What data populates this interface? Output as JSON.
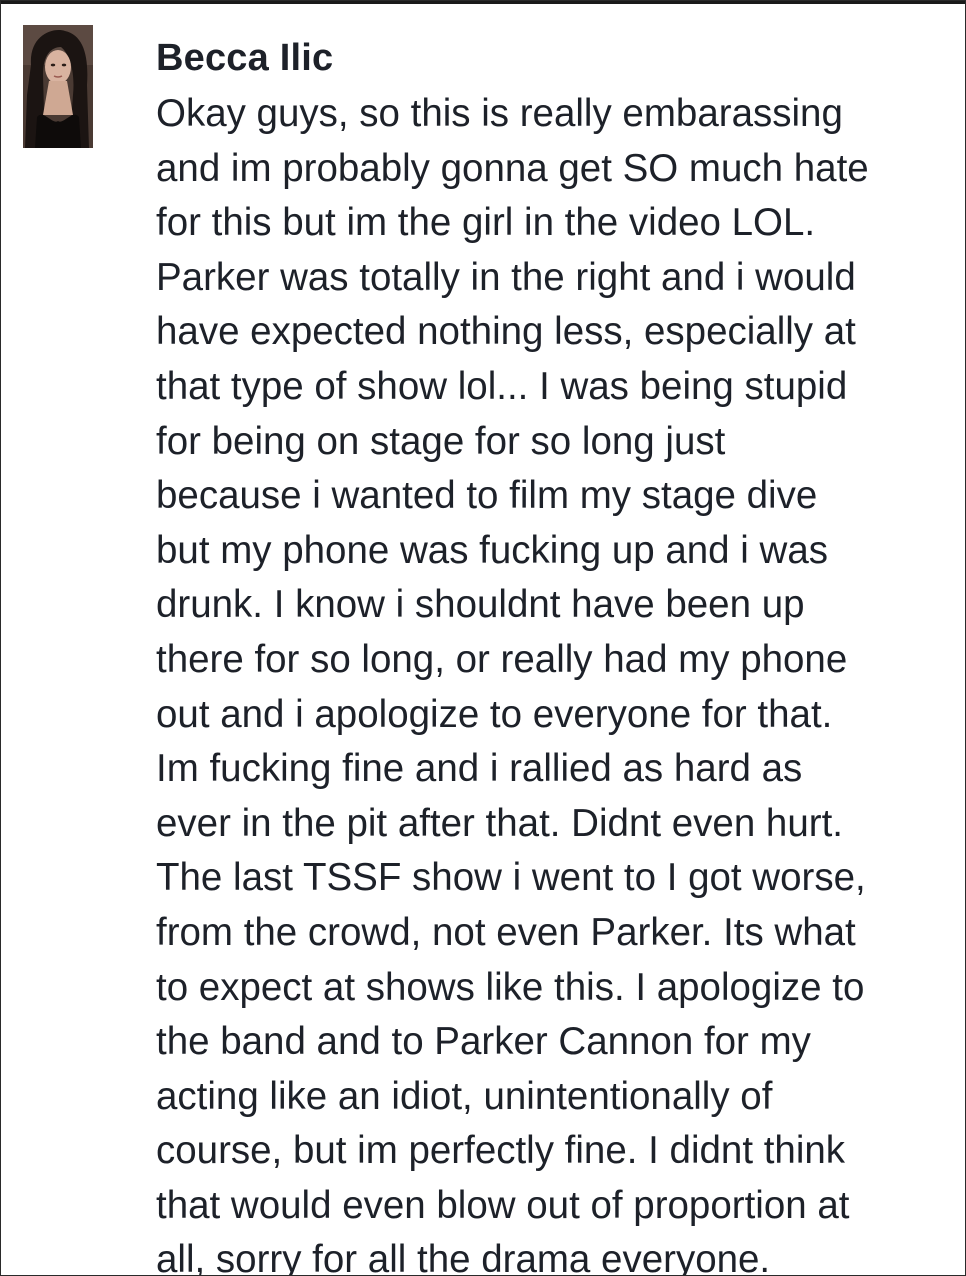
{
  "post": {
    "author": "Becca Ilic",
    "avatar_icon": "profile-photo",
    "lines": [
      "Okay guys, so this is really embarassing",
      "and im probably gonna get SO much hate",
      "for this but im the girl in the video LOL.",
      "Parker was totally in the right and i would",
      "have expected nothing less, especially at",
      "that type of show lol... I was being stupid",
      "for being on stage for so long just",
      "because i wanted to film my stage dive",
      "but my phone was fucking up and i was",
      "drunk. I know i shouldnt have been up",
      "there for so long, or really had my phone",
      "out and i apologize to everyone for that.",
      "Im fucking fine and i rallied as hard as",
      "ever in the pit after that. Didnt even hurt.",
      "The last TSSF show i went to I got worse,",
      "from the crowd, not even Parker. Its what",
      "to expect at shows like this. I apologize to",
      "the band and to Parker Cannon for my",
      "acting like an idiot, unintentionally of",
      "course, but im perfectly fine. I didnt think",
      "that would even blow out of proportion at",
      "all, sorry for all the drama everyone."
    ]
  },
  "colors": {
    "text": "#1d2129",
    "background": "#ffffff",
    "border": "#2a2a2a"
  }
}
